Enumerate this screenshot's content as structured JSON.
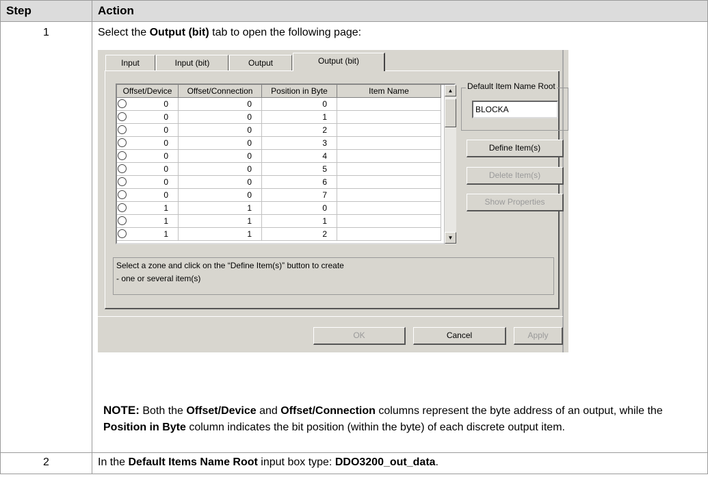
{
  "table": {
    "headers": [
      "Step",
      "Action"
    ],
    "rows": [
      {
        "step": "1",
        "line1_pre": "Select the ",
        "line1_bold": "Output (bit)",
        "line1_post": " tab to open the following page:",
        "note_label": "NOTE:",
        "note_1": " Both the ",
        "note_b1": "Offset/Device",
        "note_2": " and ",
        "note_b2": "Offset/Connection",
        "note_3": " columns represent the byte address of an output, while the ",
        "note_b3": "Position in Byte",
        "note_4": " column indicates the bit position (within the byte) of each discrete output item."
      },
      {
        "step": "2",
        "line_pre": "In the ",
        "line_bold1": "Default Items Name Root",
        "line_mid": " input box type: ",
        "line_bold2": "DDO3200_out_data",
        "line_post": "."
      }
    ]
  },
  "dialog": {
    "tabs": [
      "Input",
      "Input (bit)",
      "Output",
      "Output (bit)"
    ],
    "active_tab": "Output (bit)",
    "grid": {
      "columns": [
        "Offset/Device",
        "Offset/Connection",
        "Position in Byte",
        "Item Name"
      ],
      "rows": [
        {
          "dev": "0",
          "conn": "0",
          "pos": "0",
          "name": ""
        },
        {
          "dev": "0",
          "conn": "0",
          "pos": "1",
          "name": ""
        },
        {
          "dev": "0",
          "conn": "0",
          "pos": "2",
          "name": ""
        },
        {
          "dev": "0",
          "conn": "0",
          "pos": "3",
          "name": ""
        },
        {
          "dev": "0",
          "conn": "0",
          "pos": "4",
          "name": ""
        },
        {
          "dev": "0",
          "conn": "0",
          "pos": "5",
          "name": ""
        },
        {
          "dev": "0",
          "conn": "0",
          "pos": "6",
          "name": ""
        },
        {
          "dev": "0",
          "conn": "0",
          "pos": "7",
          "name": ""
        },
        {
          "dev": "1",
          "conn": "1",
          "pos": "0",
          "name": ""
        },
        {
          "dev": "1",
          "conn": "1",
          "pos": "1",
          "name": ""
        },
        {
          "dev": "1",
          "conn": "1",
          "pos": "2",
          "name": ""
        }
      ]
    },
    "default_root": {
      "legend": "Default Item Name Root",
      "value": "BLOCKA"
    },
    "buttons": {
      "define": "Define Item(s)",
      "delete": "Delete Item(s)",
      "show_props": "Show Properties",
      "ok": "OK",
      "cancel": "Cancel",
      "apply": "Apply"
    },
    "message": {
      "line1": "Select a zone and click on the “Define Item(s)” button to create",
      "line2": "- one or several item(s)"
    },
    "icons": {
      "scroll_up": "scroll-up-arrow-icon",
      "scroll_down": "scroll-down-arrow-icon",
      "row_marker": "radio-circle-icon"
    }
  }
}
